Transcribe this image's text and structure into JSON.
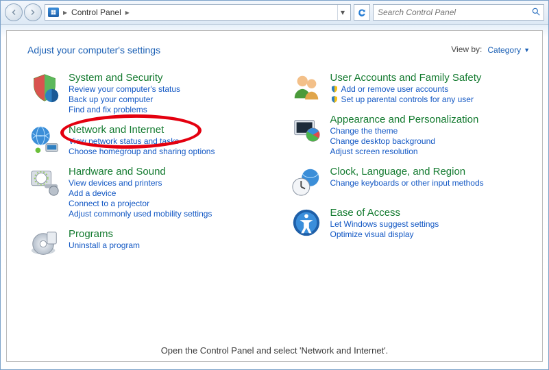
{
  "breadcrumb": {
    "root": "Control Panel"
  },
  "search": {
    "placeholder": "Search Control Panel"
  },
  "header": {
    "title": "Adjust your computer's settings",
    "viewby_label": "View by:",
    "viewby_mode": "Category"
  },
  "categories": {
    "system": {
      "title": "System and Security",
      "links": [
        "Review your computer's status",
        "Back up your computer",
        "Find and fix problems"
      ]
    },
    "network": {
      "title": "Network and Internet",
      "links": [
        "View network status and tasks",
        "Choose homegroup and sharing options"
      ]
    },
    "hardware": {
      "title": "Hardware and Sound",
      "links": [
        "View devices and printers",
        "Add a device",
        "Connect to a projector",
        "Adjust commonly used mobility settings"
      ]
    },
    "programs": {
      "title": "Programs",
      "links": [
        "Uninstall a program"
      ]
    },
    "users": {
      "title": "User Accounts and Family Safety",
      "links": [
        "Add or remove user accounts",
        "Set up parental controls for any user"
      ]
    },
    "appearance": {
      "title": "Appearance and Personalization",
      "links": [
        "Change the theme",
        "Change desktop background",
        "Adjust screen resolution"
      ]
    },
    "clock": {
      "title": "Clock, Language, and Region",
      "links": [
        "Change keyboards or other input methods"
      ]
    },
    "ease": {
      "title": "Ease of Access",
      "links": [
        "Let Windows suggest settings",
        "Optimize visual display"
      ]
    }
  },
  "caption": "Open the Control Panel and select 'Network and Internet'."
}
